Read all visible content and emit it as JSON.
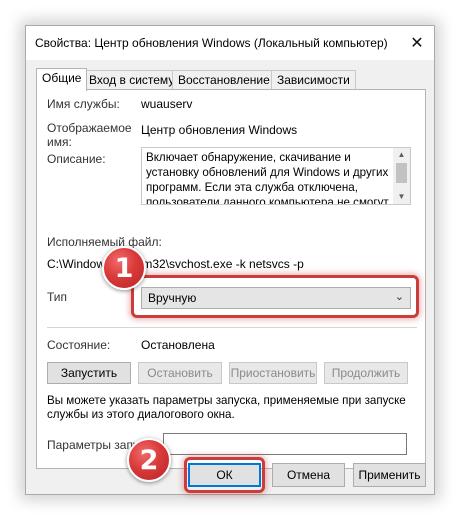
{
  "window": {
    "title": "Свойства: Центр обновления Windows (Локальный компьютер)",
    "close_glyph": "✕"
  },
  "tabs": [
    {
      "label": "Общие",
      "active": true
    },
    {
      "label": "Вход в систему",
      "active": false
    },
    {
      "label": "Восстановление",
      "active": false
    },
    {
      "label": "Зависимости",
      "active": false
    }
  ],
  "general": {
    "service_name_label": "Имя службы:",
    "service_name_value": "wuauserv",
    "display_name_label": "Отображаемое имя:",
    "display_name_value": "Центр обновления Windows",
    "description_label": "Описание:",
    "description_value": "Включает обнаружение, скачивание и установку обновлений для Windows и других программ. Если эта служба отключена, пользователи данного компьютера не смогут использовать",
    "executable_label": "Исполняемый файл:",
    "executable_value": "C:\\Windows\\system32\\svchost.exe -k netsvcs -p",
    "startup_type_label": "Тип",
    "startup_type_value": "Вручную",
    "status_label": "Состояние:",
    "status_value": "Остановлена",
    "buttons": {
      "start": "Запустить",
      "stop": "Остановить",
      "pause": "Приостановить",
      "resume": "Продолжить"
    },
    "hint_text": "Вы можете указать параметры запуска, применяемые при запуске службы из этого диалогового окна.",
    "params_label": "Параметры запуска:",
    "params_value": ""
  },
  "footer": {
    "ok": "ОК",
    "cancel": "Отмена",
    "apply": "Применить"
  },
  "annotations": {
    "badge_1": "1",
    "badge_2": "2",
    "highlight_color": "#c93d3d"
  },
  "colors": {
    "window_bg": "#f0f0f0",
    "panel_bg": "#ffffff",
    "accent": "#0078d7"
  }
}
